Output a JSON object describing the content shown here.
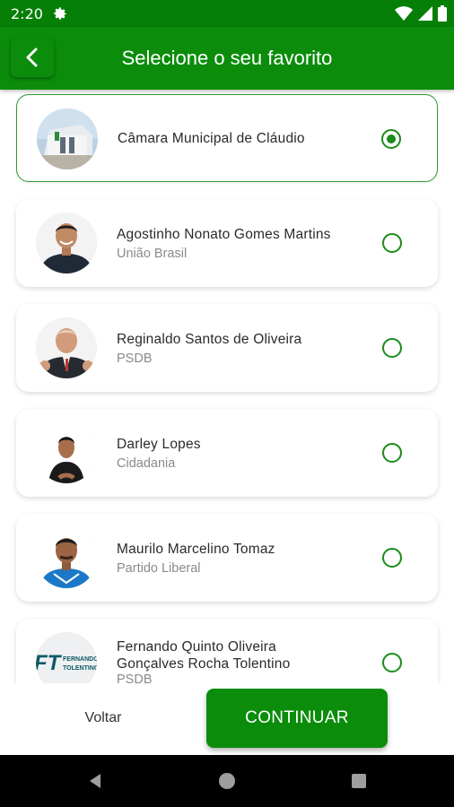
{
  "status_bar": {
    "time": "2:20",
    "icons": [
      "gear-icon",
      "wifi-icon",
      "signal-icon",
      "battery-icon"
    ]
  },
  "app_bar": {
    "title": "Selecione o seu favorito",
    "back_icon": "chevron-left-icon"
  },
  "items": [
    {
      "name": "Câmara Municipal de Cláudio",
      "party": "",
      "selected": true
    },
    {
      "name": "Agostinho Nonato Gomes Martins",
      "party": "União Brasil",
      "selected": false
    },
    {
      "name": "Reginaldo Santos de Oliveira",
      "party": "PSDB",
      "selected": false
    },
    {
      "name": "Darley Lopes",
      "party": "Cidadania",
      "selected": false
    },
    {
      "name": "Maurilo Marcelino Tomaz",
      "party": "Partido Liberal",
      "selected": false
    },
    {
      "name": "Fernando Quinto Oliveira Gonçalves Rocha Tolentino",
      "party": "PSDB",
      "selected": false,
      "logo_text": "FT",
      "logo_caption": "FERNANDO TOLENTINO"
    }
  ],
  "footer": {
    "back_label": "Voltar",
    "continue_label": "CONTINUAR"
  },
  "colors": {
    "primary": "#0b8d0b",
    "status_bar": "#067f06",
    "radio": "#1a8c1a"
  }
}
